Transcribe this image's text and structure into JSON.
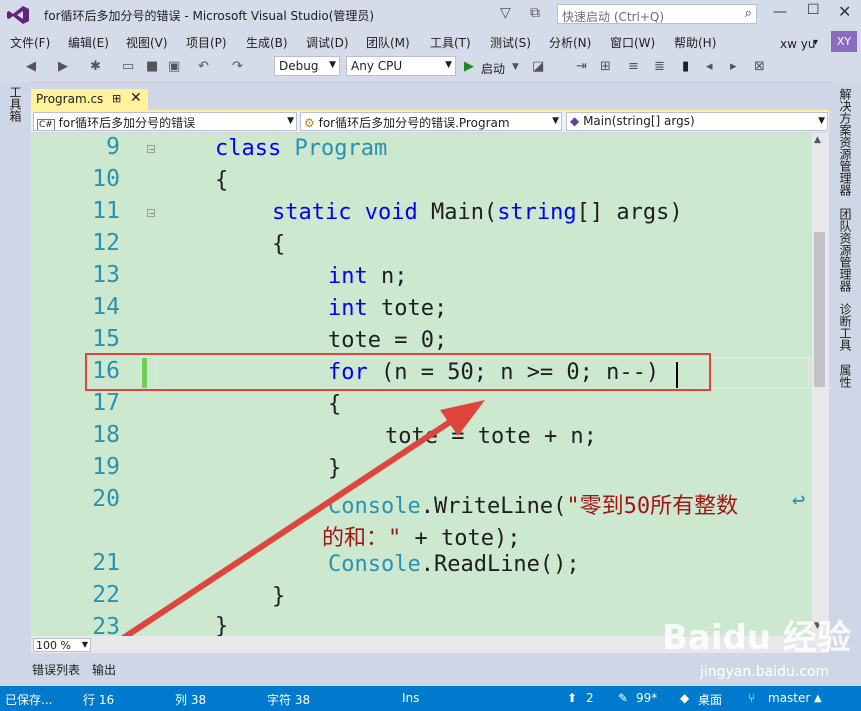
{
  "window": {
    "title": "for循环后多加分号的错误 - Microsoft Visual Studio(管理员)",
    "quick_launch_placeholder": "快速启动 (Ctrl+Q)"
  },
  "menu": [
    "文件(F)",
    "编辑(E)",
    "视图(V)",
    "项目(P)",
    "生成(B)",
    "调试(D)",
    "团队(M)",
    "工具(T)",
    "测试(S)",
    "分析(N)",
    "窗口(W)",
    "帮助(H)"
  ],
  "user": {
    "name": "xw yu",
    "initials": "XY"
  },
  "toolbar": {
    "config": "Debug",
    "platform": "Any CPU",
    "start_label": "启动"
  },
  "side_tabs": {
    "left": "工具箱",
    "right": [
      "解决方案资源管理器",
      "团队资源管理器",
      "诊断工具",
      "属性"
    ]
  },
  "document_tab": {
    "label": "Program.cs",
    "pin": "⊞",
    "close": "✕"
  },
  "nav": {
    "project": "for循环后多加分号的错误",
    "type": "for循环后多加分号的错误.Program",
    "member": "Main(string[] args)"
  },
  "code_lines": [
    {
      "num": "9"
    },
    {
      "num": "10"
    },
    {
      "num": "11"
    },
    {
      "num": "12"
    },
    {
      "num": "13"
    },
    {
      "num": "14"
    },
    {
      "num": "15"
    },
    {
      "num": "16"
    },
    {
      "num": "17"
    },
    {
      "num": "18"
    },
    {
      "num": "19"
    },
    {
      "num": "20"
    },
    {
      "num": "21"
    },
    {
      "num": "22"
    },
    {
      "num": "23"
    }
  ],
  "code_tokens": {
    "class_kw": "class",
    "program": "Program",
    "brace_open": "{",
    "brace_close": "}",
    "static_void": "static void",
    "main": "Main(",
    "string": "string",
    "args": "[] args)",
    "int": "int",
    "n_decl": " n;",
    "tote_decl": " tote;",
    "tote_init": "tote = 0;",
    "for_kw": "for",
    "for_rest": " (n = 50; n >= 0; n--)",
    "tote_sum": "tote = tote + n;",
    "console": "Console",
    "writeline": ".WriteLine(",
    "str1": "\"零到50所有整数",
    "str2": "的和：\"",
    "tail": " + tote);",
    "readline": ".ReadLine();",
    "wrap_glyph": "↩"
  },
  "zoom": "100 %",
  "bottom_tabs": [
    "错误列表",
    "输出"
  ],
  "status": {
    "state": "已保存...",
    "line": "行 16",
    "col": "列 38",
    "char": "字符 38",
    "mode": "Ins",
    "up_count": "2",
    "pending": "99*",
    "repo": "桌面",
    "branch": "master"
  },
  "watermark": {
    "brand": "Baidu 经验",
    "url": "jingyan.baidu.com"
  },
  "colors": {
    "editor_bg": "#cce8cf",
    "keyword": "#0000ff",
    "type": "#2b91af",
    "string": "#a31515",
    "highlight": "#e0453d",
    "status_bar": "#007acc"
  }
}
